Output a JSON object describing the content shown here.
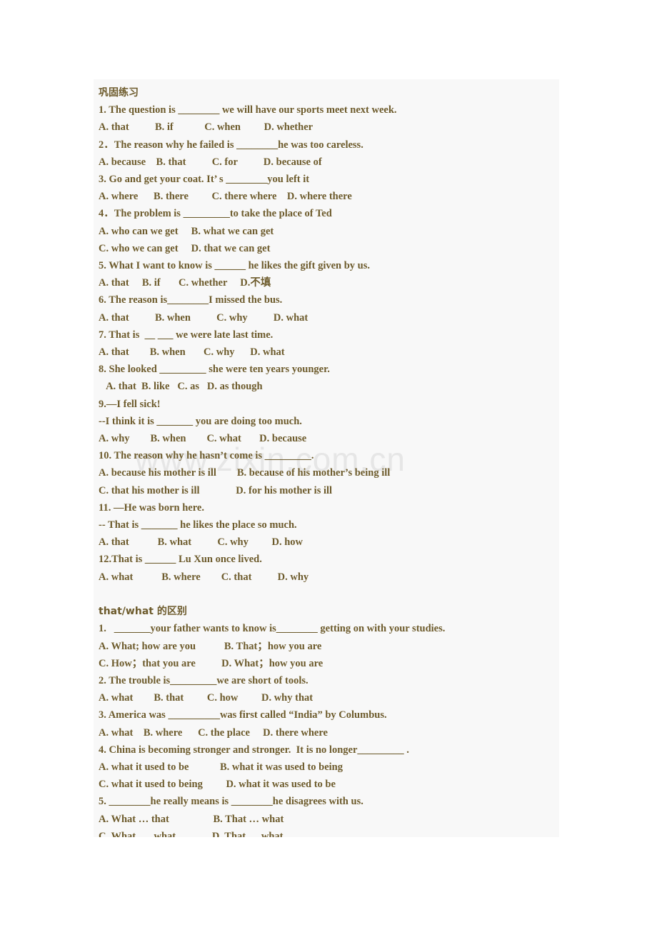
{
  "document": {
    "background_color": "#ffffff",
    "panel_color": "#f8f8f8",
    "text_color": "#6d5b2c",
    "watermark": "www.zixin.com.cn",
    "watermark_color": "#e6e6e6"
  },
  "sections": [
    {
      "heading": "巩固练习",
      "lines": [
        "1. The question is ________ we will have our sports meet next week.",
        "A. that          B. if            C. when         D. whether",
        "2．The reason why he failed is ________he was too careless.",
        "A. because    B. that          C. for          D. because of",
        "3. Go and get your coat. It’ s ________you left it",
        "A. where      B. there         C. there where    D. where there",
        "4．The problem is _________to take the place of Ted",
        "A. who can we get     B. what we can get",
        "C. who we can get     D. that we can get",
        "5. What I want to know is ______ he likes the gift given by us.",
        "A. that     B. if       C. whether     D.不填",
        "6. The reason is________I missed the bus.",
        "A. that          B. when          C. why          D. what",
        "7. That is  __ ___ we were late last time.",
        "A. that        B. when       C. why      D. what",
        "8. She looked _________ she were ten years younger.",
        "   A. that  B. like   C. as   D. as though",
        "9.—I fell sick!",
        "--I think it is _______ you are doing too much.",
        "A. why        B. when        C. what       D. because",
        "10. The reason why he hasn’t come is _________.",
        "A. because his mother is ill        B. because of his mother’s being ill",
        "C. that his mother is ill              D. for his mother is ill",
        "11. —He was born here.",
        "-- That is _______ he likes the place so much.",
        "A. that           B. what          C. why         D. how",
        "12.That is ______ Lu Xun once lived.",
        "A. what           B. where        C. that          D. why"
      ]
    },
    {
      "heading": "that/what 的区别",
      "lines": [
        "1.   _______your father wants to know is________ getting on with your studies.",
        "A. What; how are you           B. That；how you are",
        "C. How；that you are          D. What；how you are",
        "2. The trouble is_________we are short of tools.",
        "A. what        B. that         C. how         D. why that",
        "3. America was __________was first called “India” by Columbus.",
        "A. what    B. where      C. the place     D. there where",
        "4. China is becoming stronger and stronger.  It is no longer_________ .",
        "A. what it used to be            B. what it was used to being",
        "C. what it used to being         D. what it was used to be",
        "5. ________he really means is ________he disagrees with us.",
        "A. What … that                 B. That … what",
        "C. What  … what              D. That … what"
      ]
    }
  ]
}
